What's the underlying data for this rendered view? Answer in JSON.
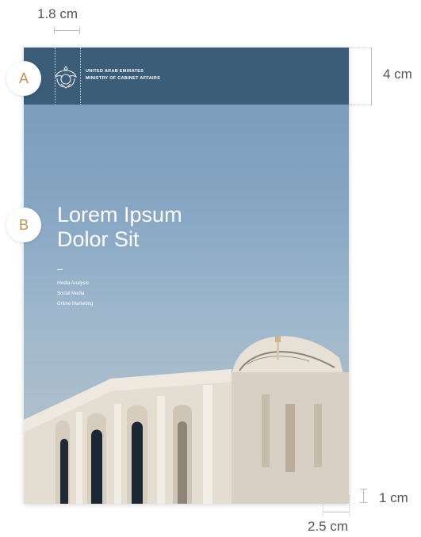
{
  "dimensions": {
    "logo_width": "1.8 cm",
    "header_height": "4 cm",
    "bottom_margin": "1 cm",
    "side_margin": "2.5 cm"
  },
  "markers": {
    "a": "A",
    "b": "B"
  },
  "header": {
    "org_line1": "UNITED ARAB EMIRATES",
    "org_line2": "MINISTRY OF CABINET AFFAIRS",
    "background": "#3b5d78"
  },
  "cover": {
    "title_line1": "Lorem Ipsum",
    "title_line2": "Dolor Sit",
    "tags": [
      "Media Analysis",
      "Social Media",
      "Online Marketing"
    ]
  },
  "colors": {
    "accent": "#b9955c",
    "sky": "#86a6c4"
  },
  "icons": {
    "emblem": "falcon-emblem-icon"
  }
}
